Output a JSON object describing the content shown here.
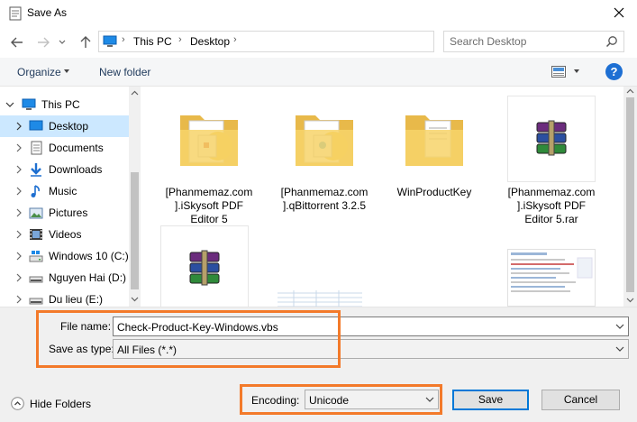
{
  "window": {
    "title": "Save As"
  },
  "address": {
    "crumbs": [
      "This PC",
      "Desktop"
    ]
  },
  "search": {
    "placeholder": "Search Desktop"
  },
  "toolbar": {
    "organize_label": "Organize",
    "new_folder_label": "New folder",
    "help_label": "?"
  },
  "sidebar": {
    "items": [
      {
        "label": "This PC",
        "icon": "pc-icon"
      },
      {
        "label": "Desktop",
        "icon": "desktop-icon"
      },
      {
        "label": "Documents",
        "icon": "documents-icon"
      },
      {
        "label": "Downloads",
        "icon": "downloads-icon"
      },
      {
        "label": "Music",
        "icon": "music-icon"
      },
      {
        "label": "Pictures",
        "icon": "pictures-icon"
      },
      {
        "label": "Videos",
        "icon": "videos-icon"
      },
      {
        "label": "Windows 10 (C:)",
        "icon": "windows-drive-icon"
      },
      {
        "label": "Nguyen Hai (D:)",
        "icon": "drive-icon"
      },
      {
        "label": "Du lieu (E:)",
        "icon": "drive-icon"
      }
    ]
  },
  "files": [
    {
      "name": "[Phanmemaz.com].iSkysoft PDF Editor 5",
      "icon": "folder-icon"
    },
    {
      "name": "[Phanmemaz.com].qBittorrent 3.2.5",
      "icon": "folder-icon"
    },
    {
      "name": "WinProductKey",
      "icon": "folder-icon"
    },
    {
      "name": "[Phanmemaz.com].iSkysoft PDF Editor 5.rar",
      "icon": "winrar-archive-icon"
    },
    {
      "name": "",
      "icon": "winrar-archive-icon"
    },
    {
      "name": "",
      "icon": "spreadsheet-thumbnail-icon"
    },
    {
      "name": "",
      "icon": "webpage-thumbnail-icon"
    }
  ],
  "form": {
    "file_name_label": "File name:",
    "file_name_value": "Check-Product-Key-Windows.vbs",
    "save_type_label": "Save as type:",
    "save_type_value": "All Files  (*.*)",
    "encoding_label": "Encoding:",
    "encoding_value": "Unicode"
  },
  "buttons": {
    "hide_folders_label": "Hide Folders",
    "save_label": "Save",
    "cancel_label": "Cancel"
  },
  "colors": {
    "highlight_box": "#f37a2a",
    "selected_row": "#cce8ff",
    "accent": "#0078d7"
  }
}
